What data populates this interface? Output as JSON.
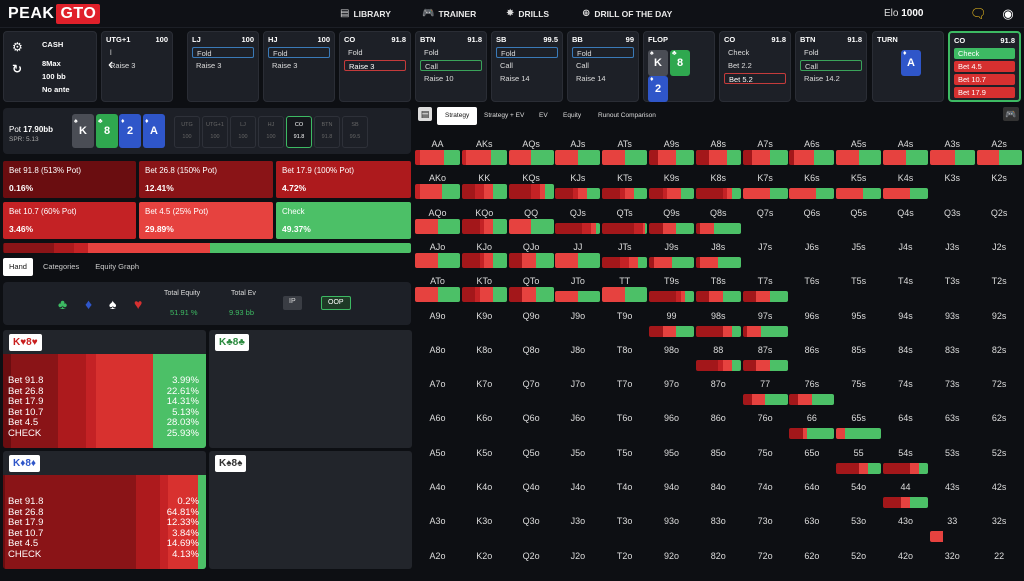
{
  "logo": {
    "part1": "PEAK",
    "part2": "GTO"
  },
  "nav": [
    {
      "icon": "▤",
      "label": "LIBRARY"
    },
    {
      "icon": "🎮",
      "label": "TRAINER"
    },
    {
      "icon": "✸",
      "label": "DRILLS"
    },
    {
      "icon": "⊕",
      "label": "DRILL OF THE DAY"
    }
  ],
  "elo": {
    "label": "Elo",
    "value": "1000"
  },
  "game": {
    "type": "CASH",
    "players": "8Max",
    "stack": "100 bb",
    "ante": "No ante"
  },
  "seats": [
    {
      "pos": "UTG+1",
      "stack": "100",
      "actions": [
        {
          "t": "l",
          "c": ""
        },
        {
          "t": "Raise 3",
          "c": ""
        }
      ]
    },
    {
      "pos": "LJ",
      "stack": "100",
      "actions": [
        {
          "t": "Fold",
          "c": "selb"
        },
        {
          "t": "Raise 3",
          "c": ""
        }
      ]
    },
    {
      "pos": "HJ",
      "stack": "100",
      "actions": [
        {
          "t": "Fold",
          "c": "selb"
        },
        {
          "t": "Raise 3",
          "c": ""
        }
      ]
    },
    {
      "pos": "CO",
      "stack": "91.8",
      "actions": [
        {
          "t": "Fold",
          "c": ""
        },
        {
          "t": "Raise 3",
          "c": "sel"
        }
      ]
    },
    {
      "pos": "BTN",
      "stack": "91.8",
      "actions": [
        {
          "t": "Fold",
          "c": ""
        },
        {
          "t": "Call",
          "c": "selg"
        },
        {
          "t": "Raise 10",
          "c": ""
        }
      ]
    },
    {
      "pos": "SB",
      "stack": "99.5",
      "actions": [
        {
          "t": "Fold",
          "c": "selb"
        },
        {
          "t": "Call",
          "c": ""
        },
        {
          "t": "Raise 14",
          "c": ""
        }
      ]
    },
    {
      "pos": "BB",
      "stack": "99",
      "actions": [
        {
          "t": "Fold",
          "c": "selb"
        },
        {
          "t": "Call",
          "c": ""
        },
        {
          "t": "Raise 14",
          "c": ""
        }
      ]
    },
    {
      "pos": "CO",
      "stack": "91.8",
      "actions": [
        {
          "t": "Check",
          "c": ""
        },
        {
          "t": "Bet 2.2",
          "c": ""
        },
        {
          "t": "Bet 5.2",
          "c": "sel"
        }
      ]
    },
    {
      "pos": "BTN",
      "stack": "91.8",
      "actions": [
        {
          "t": "Fold",
          "c": ""
        },
        {
          "t": "Call",
          "c": "selg"
        },
        {
          "t": "Raise 14.2",
          "c": ""
        }
      ]
    }
  ],
  "flop": {
    "label": "FLOP",
    "cards": [
      {
        "r": "K",
        "s": "♠",
        "bg": "#4a4d55"
      },
      {
        "r": "8",
        "s": "♣",
        "bg": "#2fa84f"
      },
      {
        "r": "2",
        "s": "♦",
        "bg": "#2f56c9"
      }
    ]
  },
  "turn": {
    "label": "TURN",
    "card": {
      "r": "A",
      "s": "♦",
      "bg": "#2f56c9"
    }
  },
  "current": {
    "pos": "CO",
    "stack": "91.8",
    "actions": [
      {
        "t": "Check",
        "c": "grn"
      },
      {
        "t": "Bet 4.5",
        "c": "red"
      },
      {
        "t": "Bet 10.7",
        "c": "red"
      },
      {
        "t": "Bet 17.9",
        "c": "red"
      }
    ]
  },
  "pot": {
    "label": "Pot",
    "value": "17.90bb",
    "spr": "SPR: 5.13"
  },
  "board": [
    {
      "r": "K",
      "s": "♠",
      "bg": "#4a4d55"
    },
    {
      "r": "8",
      "s": "♣",
      "bg": "#2fa84f"
    },
    {
      "r": "2",
      "s": "♦",
      "bg": "#2f56c9"
    },
    {
      "r": "A",
      "s": "♦",
      "bg": "#2f56c9"
    }
  ],
  "minis": [
    {
      "p": "UTG",
      "v": "100"
    },
    {
      "p": "UTG+1",
      "v": "100"
    },
    {
      "p": "LJ",
      "v": "100"
    },
    {
      "p": "HJ",
      "v": "100"
    },
    {
      "p": "CO",
      "v": "91.8",
      "on": true
    },
    {
      "p": "BTN",
      "v": "91.8"
    },
    {
      "p": "SB",
      "v": "99.5"
    }
  ],
  "actions": [
    {
      "label": "Bet 91.8 (513% Pot)",
      "pct": "0.16%",
      "bg": "#6a0d10"
    },
    {
      "label": "Bet 26.8 (150% Pot)",
      "pct": "12.41%",
      "bg": "#8a1417"
    },
    {
      "label": "Bet 17.9 (100% Pot)",
      "pct": "4.72%",
      "bg": "#ad1a1d"
    },
    {
      "label": "Bet 10.7 (60% Pot)",
      "pct": "3.46%",
      "bg": "#c42225"
    },
    {
      "label": "Bet 4.5 (25% Pot)",
      "pct": "29.89%",
      "bg": "#e6423f"
    },
    {
      "label": "Check",
      "pct": "49.37%",
      "bg": "#4cc067"
    }
  ],
  "tabs": [
    "Hand",
    "Categories",
    "Equity Graph"
  ],
  "equity": {
    "total_equity_label": "Total Equity",
    "total_equity": "51.91 %",
    "total_ev_label": "Total Ev",
    "total_ev": "9.93 bb",
    "ip": "IP",
    "oop": "OOP"
  },
  "combos": [
    {
      "hand": "K♥8♥",
      "rc": "#c81e1e",
      "shares": [
        0.04,
        0.23,
        0.14,
        0.05,
        0.28,
        0.26
      ],
      "labels": [
        "Bet 91.8",
        "Bet 26.8",
        "Bet 17.9",
        "Bet 10.7",
        "Bet 4.5",
        "CHECK"
      ],
      "values": [
        "3.99%",
        "22.61%",
        "14.31%",
        "5.13%",
        "28.03%",
        "25.93%"
      ]
    },
    {
      "hand": "K♣8♣",
      "rc": "#2a8a3e",
      "shares": [],
      "labels": [],
      "values": []
    },
    {
      "hand": "K♦8♦",
      "rc": "#2f56c9",
      "shares": [
        0.01,
        0.65,
        0.12,
        0.04,
        0.15,
        0.04
      ],
      "labels": [
        "Bet 91.8",
        "Bet 26.8",
        "Bet 17.9",
        "Bet 10.7",
        "Bet 4.5",
        "CHECK"
      ],
      "values": [
        "0.2%",
        "64.81%",
        "12.33%",
        "3.84%",
        "14.69%",
        "4.13%"
      ]
    },
    {
      "hand": "K♠8♠",
      "rc": "#333",
      "shares": [],
      "labels": [],
      "values": []
    }
  ],
  "strategy_tabs": [
    "Strategy",
    "Strategy + EV",
    "EV",
    "Equity",
    "Runout Comparison"
  ],
  "ranks": [
    "A",
    "K",
    "Q",
    "J",
    "T",
    "9",
    "8",
    "7",
    "6",
    "5",
    "4",
    "3",
    "2"
  ],
  "grid_strategy": {
    "AA": [
      0,
      0,
      0.1,
      0,
      0.55,
      0.35
    ],
    "AKs": [
      0,
      0,
      0.1,
      0,
      0.55,
      0.35
    ],
    "AQs": [
      0,
      0,
      0,
      0,
      0.5,
      0.5
    ],
    "AJs": [
      0,
      0,
      0,
      0,
      0.5,
      0.5
    ],
    "ATs": [
      0,
      0,
      0,
      0,
      0.5,
      0.5
    ],
    "A9s": [
      0,
      0.2,
      0,
      0,
      0.4,
      0.4
    ],
    "A8s": [
      0,
      0.3,
      0,
      0,
      0.4,
      0.3
    ],
    "A7s": [
      0,
      0.2,
      0,
      0,
      0.4,
      0.4
    ],
    "A6s": [
      0,
      0.1,
      0,
      0,
      0.45,
      0.45
    ],
    "A5s": [
      0,
      0,
      0,
      0,
      0.5,
      0.5
    ],
    "A4s": [
      0,
      0,
      0,
      0,
      0.5,
      0.5
    ],
    "A3s": [
      0,
      0,
      0,
      0,
      0.55,
      0.45
    ],
    "A2s": [
      0,
      0,
      0,
      0,
      0.5,
      0.5
    ],
    "AKo": [
      0,
      0,
      0.1,
      0,
      0.5,
      0.4
    ],
    "KK": [
      0,
      0.3,
      0.2,
      0,
      0.2,
      0.3
    ],
    "KQs": [
      0,
      0.5,
      0.2,
      0,
      0.1,
      0.2
    ],
    "KJs": [
      0,
      0.4,
      0.1,
      0,
      0.2,
      0.3
    ],
    "KTs": [
      0,
      0.4,
      0.1,
      0,
      0.2,
      0.3
    ],
    "K9s": [
      0,
      0.3,
      0.1,
      0,
      0.3,
      0.3
    ],
    "K8s": [
      0,
      0.6,
      0.1,
      0,
      0.1,
      0.2
    ],
    "K7s": [
      0,
      0,
      0,
      0,
      0.6,
      0.4
    ],
    "K6s": [
      0,
      0,
      0,
      0,
      0.6,
      0.4
    ],
    "K5s": [
      0,
      0,
      0,
      0,
      0.6,
      0.4
    ],
    "K4s": [
      0,
      0,
      0,
      0,
      0.6,
      0.4
    ],
    "AQo": [
      0,
      0,
      0,
      0,
      0.5,
      0.5
    ],
    "KQo": [
      0,
      0.4,
      0.1,
      0,
      0.2,
      0.3
    ],
    "QQ": [
      0,
      0,
      0,
      0,
      0.5,
      0.5
    ],
    "QJs": [
      0,
      0.6,
      0.2,
      0,
      0.1,
      0.1
    ],
    "QTs": [
      0,
      0.7,
      0.2,
      0,
      0.05,
      0.05
    ],
    "Q9s": [
      0,
      0.3,
      0,
      0,
      0.3,
      0.4
    ],
    "Q8s": [
      0,
      0.1,
      0,
      0,
      0.3,
      0.6
    ],
    "AJo": [
      0,
      0,
      0,
      0,
      0.5,
      0.5
    ],
    "KJo": [
      0,
      0.4,
      0.1,
      0,
      0.2,
      0.3
    ],
    "QJo": [
      0,
      0.3,
      0,
      0,
      0.3,
      0.4
    ],
    "JJ": [
      0,
      0,
      0,
      0,
      0.5,
      0.5
    ],
    "JTs": [
      0,
      0.4,
      0.2,
      0,
      0.2,
      0.2
    ],
    "J9s": [
      0,
      0.1,
      0,
      0,
      0.4,
      0.5
    ],
    "J8s": [
      0,
      0.1,
      0,
      0,
      0.4,
      0.5
    ],
    "ATo": [
      0,
      0,
      0,
      0,
      0.5,
      0.5
    ],
    "KTo": [
      0,
      0.3,
      0.1,
      0,
      0.3,
      0.3
    ],
    "QTo": [
      0,
      0.3,
      0,
      0,
      0.3,
      0.4
    ],
    "JTo": [
      0,
      0,
      0,
      0,
      0.5,
      0.5
    ],
    "TT": [
      0,
      0,
      0,
      0,
      0.5,
      0.5
    ],
    "T9s": [
      0,
      0.6,
      0.1,
      0,
      0.1,
      0.2
    ],
    "T8s": [
      0,
      0.3,
      0,
      0,
      0.3,
      0.4
    ],
    "T7s": [
      0,
      0.3,
      0,
      0,
      0.3,
      0.4
    ],
    "99": [
      0,
      0.3,
      0,
      0,
      0.3,
      0.4
    ],
    "98s": [
      0,
      0.6,
      0,
      0,
      0.2,
      0.2
    ],
    "97s": [
      0,
      0.1,
      0,
      0,
      0.3,
      0.6
    ],
    "88": [
      0,
      0.5,
      0.1,
      0,
      0.2,
      0.2
    ],
    "87s": [
      0,
      0.3,
      0,
      0,
      0.3,
      0.4
    ],
    "77": [
      0,
      0.2,
      0,
      0,
      0.3,
      0.5
    ],
    "76s": [
      0,
      0.2,
      0,
      0,
      0.3,
      0.5
    ],
    "66": [
      0,
      0.3,
      0,
      0,
      0.1,
      0.6
    ],
    "65s": [
      0,
      0,
      0,
      0,
      0.2,
      0.8
    ],
    "55": [
      0,
      0.5,
      0,
      0,
      0.2,
      0.3
    ],
    "54s": [
      0,
      0.6,
      0,
      0,
      0.2,
      0.2
    ],
    "44": [
      0,
      0.4,
      0,
      0,
      0.2,
      0.4
    ],
    "33": [
      0,
      0,
      0,
      0,
      0.3,
      0
    ]
  }
}
